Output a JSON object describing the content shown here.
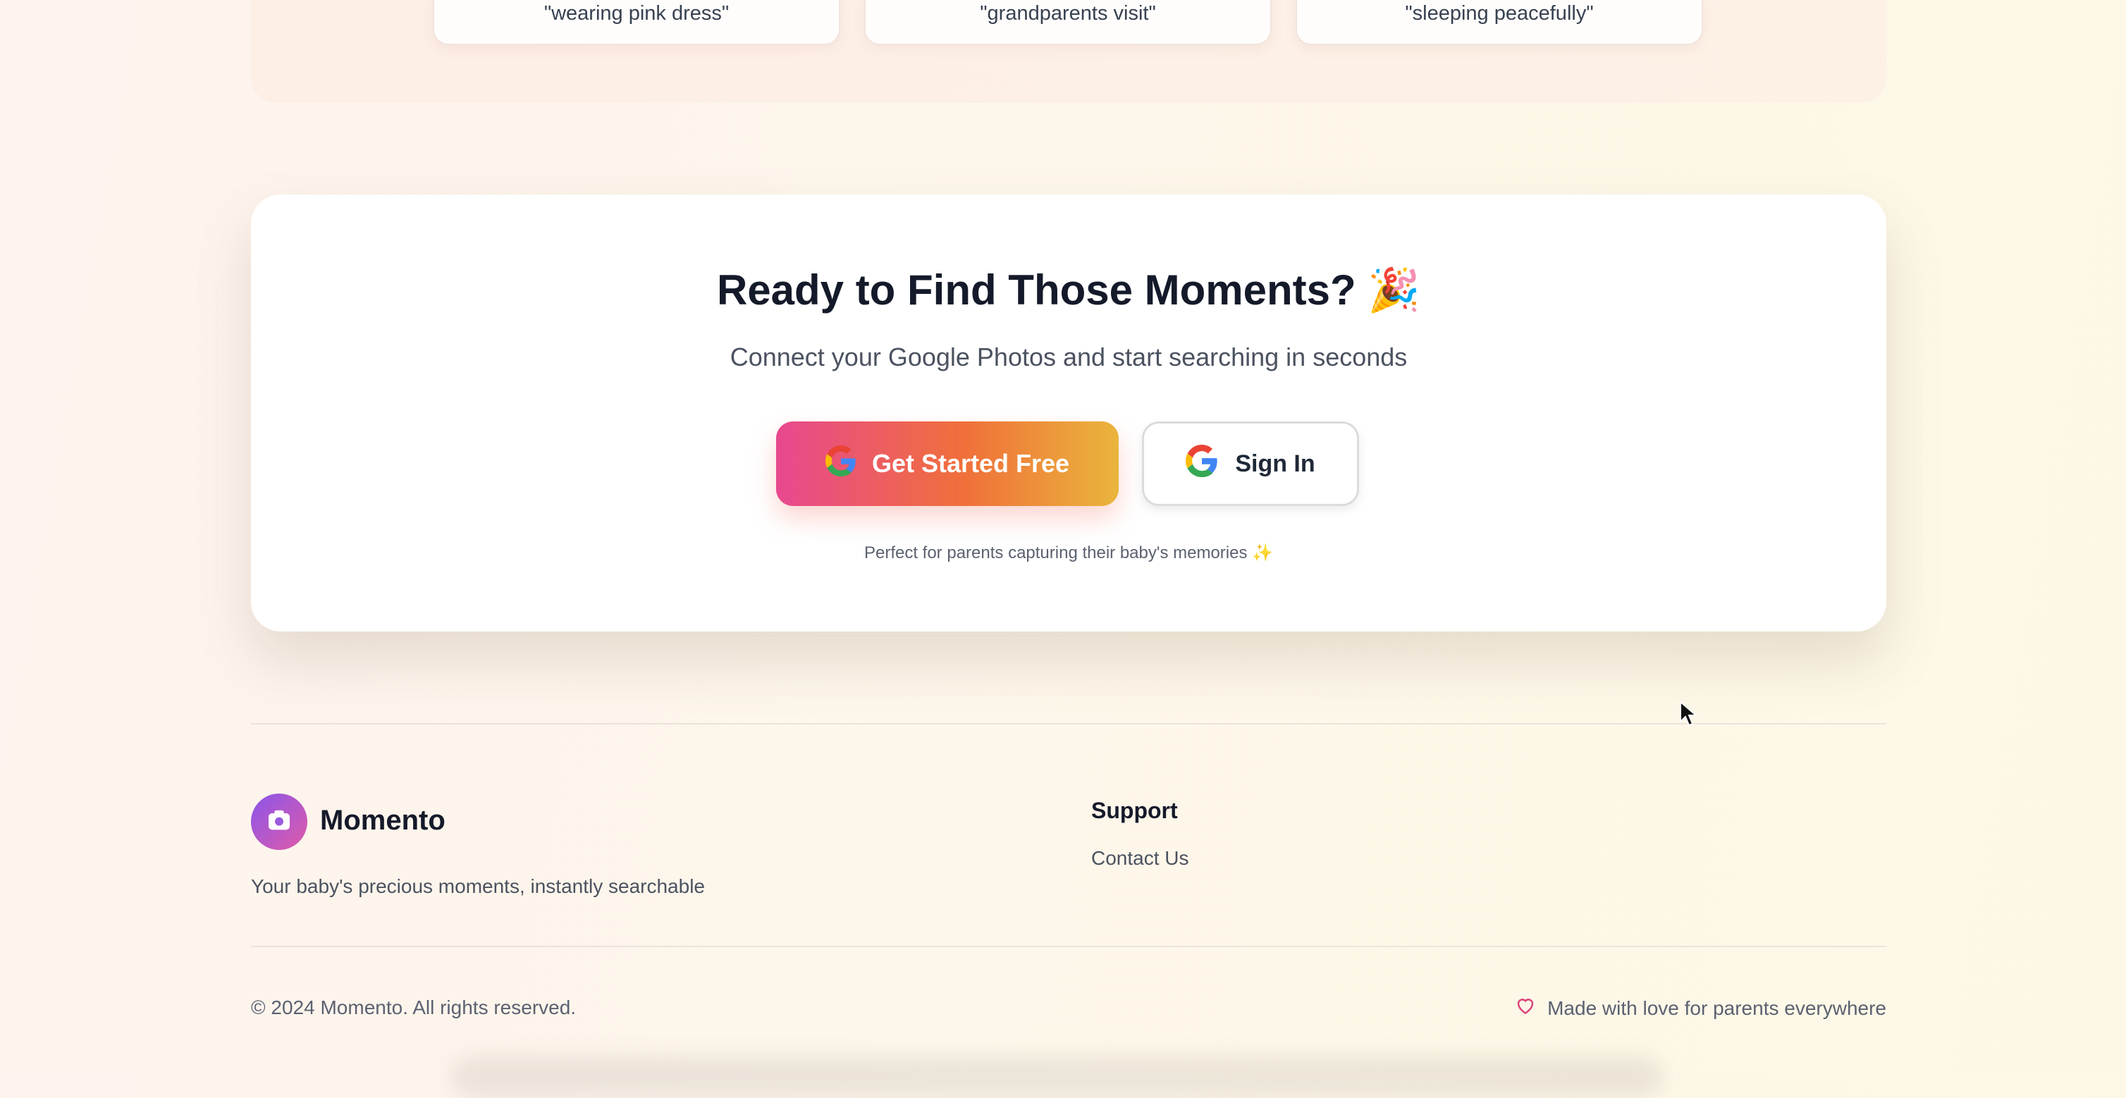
{
  "example_searches": [
    "\"wearing pink dress\"",
    "\"grandparents visit\"",
    "\"sleeping peacefully\""
  ],
  "cta": {
    "title": "Ready to Find Those Moments?",
    "title_emoji": "🎉",
    "subtitle": "Connect your Google Photos and start searching in seconds",
    "primary_button": "Get Started Free",
    "secondary_button": "Sign In",
    "note": "Perfect for parents capturing their baby's memories",
    "note_emoji": "✨"
  },
  "footer": {
    "brand": "Momento",
    "tagline": "Your baby's precious moments, instantly searchable",
    "support_title": "Support",
    "support_links": [
      "Contact Us"
    ],
    "copyright": "© 2024 Momento. All rights reserved.",
    "made_with": "Made with love for parents everywhere"
  },
  "colors": {
    "primary_gradient": [
      "#e8488f",
      "#f0703a",
      "#eab53c"
    ],
    "logo_gradient": [
      "#8a56ea",
      "#e05aa8"
    ],
    "heart": "#d9467a",
    "heading": "#151a2a"
  },
  "icons": {
    "google": "google-icon",
    "camera": "camera-icon",
    "heart": "heart-icon",
    "cursor": "mouse-cursor"
  }
}
